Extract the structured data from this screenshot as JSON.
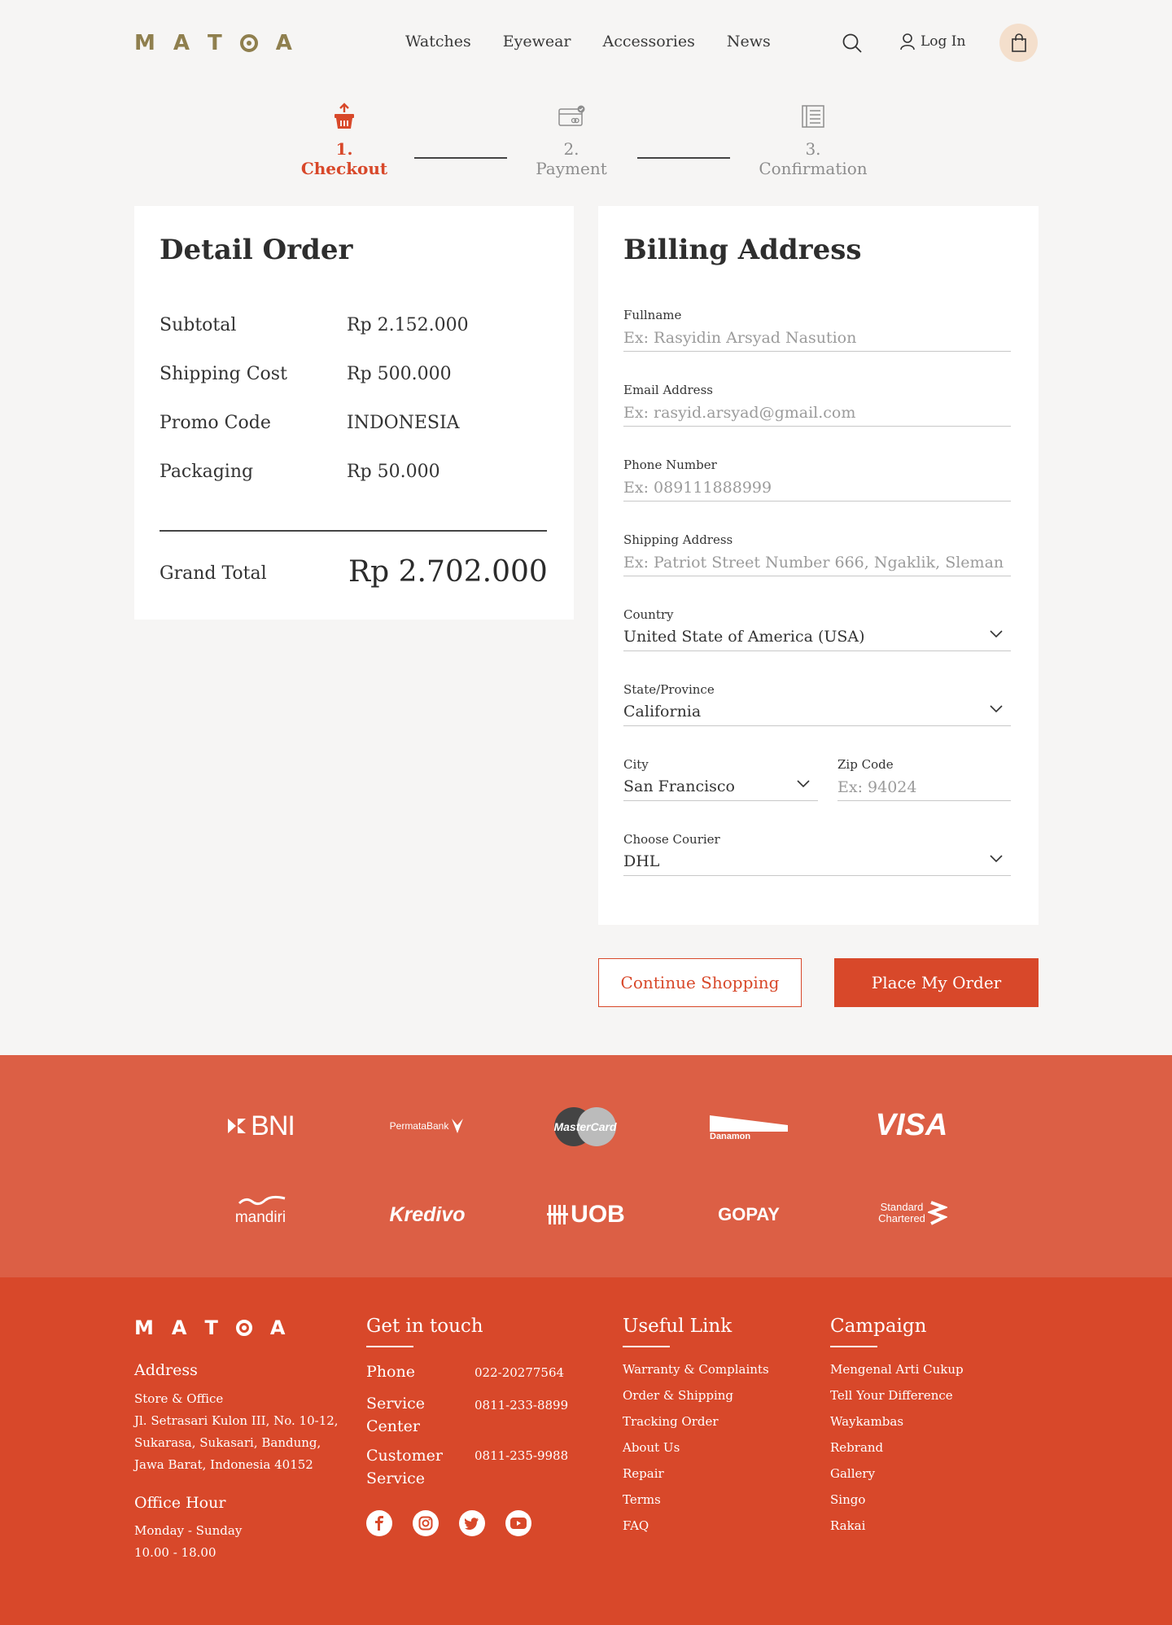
{
  "brand": {
    "logo_letters": [
      "M",
      "A",
      "T",
      "O",
      "A"
    ]
  },
  "nav": {
    "items": [
      "Watches",
      "Eyewear",
      "Accessories",
      "News"
    ],
    "login_label": "Log In"
  },
  "steps": [
    {
      "label": "1. Checkout",
      "active": true
    },
    {
      "label": "2. Payment",
      "active": false
    },
    {
      "label": "3. Confirmation",
      "active": false
    }
  ],
  "detail_order": {
    "title": "Detail Order",
    "rows": [
      {
        "label": "Subtotal",
        "value": "Rp 2.152.000"
      },
      {
        "label": "Shipping Cost",
        "value": "Rp 500.000"
      },
      {
        "label": "Promo Code",
        "value": "INDONESIA"
      },
      {
        "label": "Packaging",
        "value": "Rp 50.000"
      }
    ],
    "grand_total_label": "Grand Total",
    "grand_total_value": "Rp 2.702.000"
  },
  "billing": {
    "title": "Billing Address",
    "fullname": {
      "label": "Fullname",
      "placeholder": "Ex: Rasyidin Arsyad Nasution",
      "value": ""
    },
    "email": {
      "label": "Email Address",
      "placeholder": "Ex: rasyid.arsyad@gmail.com",
      "value": ""
    },
    "phone": {
      "label": "Phone Number",
      "placeholder": "Ex: 089111888999",
      "value": ""
    },
    "address": {
      "label": "Shipping Address",
      "placeholder": "Ex: Patriot Street Number 666, Ngaklik, Sleman",
      "value": ""
    },
    "country": {
      "label": "Country",
      "value": "United State of America (USA)"
    },
    "state": {
      "label": "State/Province",
      "value": "California"
    },
    "city": {
      "label": "City",
      "value": "San Francisco"
    },
    "zip": {
      "label": "Zip Code",
      "placeholder": "Ex: 94024",
      "value": ""
    },
    "courier": {
      "label": "Choose Courier",
      "value": "DHL"
    }
  },
  "actions": {
    "continue_label": "Continue Shopping",
    "order_label": "Place My Order"
  },
  "partners": [
    "BNI",
    "PermataBank",
    "MasterCard",
    "Danamon",
    "VISA",
    "mandiri",
    "Kredivo",
    "UOB",
    "GOPAY",
    "Standard Chartered"
  ],
  "footer": {
    "address_title": "Address",
    "address_lines": [
      "Store & Office",
      "Jl. Setrasari Kulon III, No. 10-12,",
      "Sukarasa, Sukasari, Bandung,",
      "Jawa Barat, Indonesia 40152"
    ],
    "hours_title": "Office Hour",
    "hours_lines": [
      "Monday - Sunday",
      "10.00 - 18.00"
    ],
    "touch_title": "Get in touch",
    "contacts": [
      {
        "label": "Phone",
        "value": "022-20277564"
      },
      {
        "label": "Service Center",
        "value": "0811-233-8899"
      },
      {
        "label": "Customer Service",
        "value": "0811-235-9988"
      }
    ],
    "useful_title": "Useful Link",
    "useful_links": [
      "Warranty & Complaints",
      "Order & Shipping",
      "Tracking Order",
      "About Us",
      "Repair",
      "Terms",
      "FAQ"
    ],
    "campaign_title": "Campaign",
    "campaign_links": [
      "Mengenal Arti Cukup",
      "Tell Your Difference",
      "Waykambas",
      "Rebrand",
      "Gallery",
      "Singo",
      "Rakai"
    ],
    "social": [
      "facebook-icon",
      "instagram-icon",
      "twitter-icon",
      "youtube-icon"
    ]
  },
  "colors": {
    "accent": "#d8482a",
    "partners_bg": "#dc5f45",
    "logo_gold": "#8f7f4e",
    "page_bg": "#f6f5f4"
  }
}
